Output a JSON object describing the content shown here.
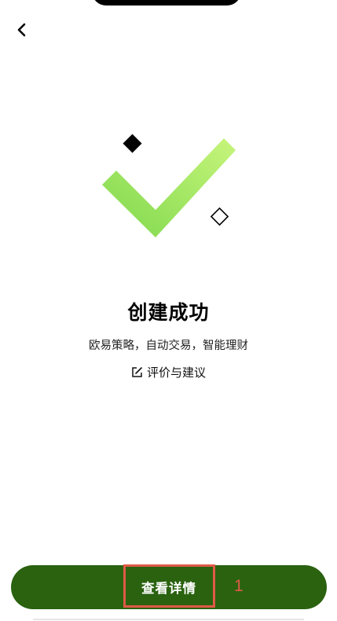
{
  "header": {
    "back_icon": "chevron-left-icon"
  },
  "hero": {
    "icon": "check-mark-icon",
    "colors": {
      "check_light": "#c7f57b",
      "check_dark": "#7fd84e"
    }
  },
  "result": {
    "title": "创建成功",
    "subtitle": "欧易策略，自动交易，智能理财",
    "feedback_label": "评价与建议",
    "feedback_icon": "edit-icon"
  },
  "footer": {
    "view_details_label": "查看详情",
    "button_color": "#2a6210",
    "annotation_marker": "1",
    "annotation_color": "#e05a47"
  }
}
